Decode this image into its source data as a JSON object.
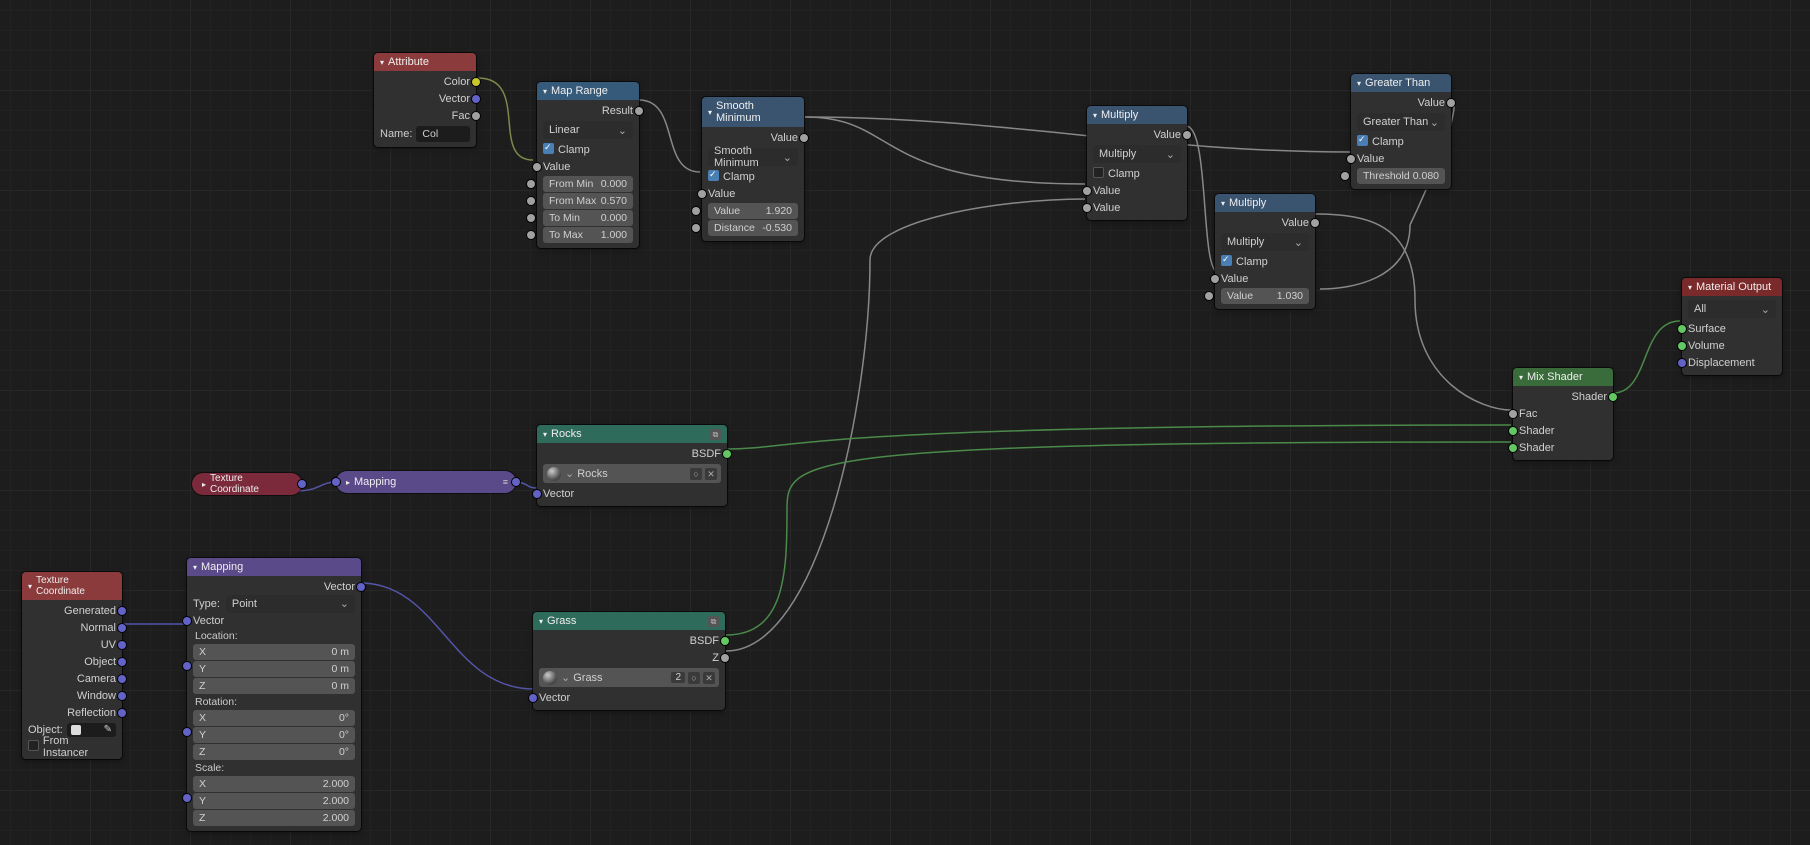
{
  "attribute": {
    "title": "Attribute",
    "out_color": "Color",
    "out_vector": "Vector",
    "out_fac": "Fac",
    "name_label": "Name:",
    "name_value": "Col"
  },
  "map_range": {
    "title": "Map Range",
    "out": "Result",
    "dropdown": "Linear",
    "clamp": "Clamp",
    "in_value": "Value",
    "from_min_l": "From Min",
    "from_min_v": "0.000",
    "from_max_l": "From Max",
    "from_max_v": "0.570",
    "to_min_l": "To Min",
    "to_min_v": "0.000",
    "to_max_l": "To Max",
    "to_max_v": "1.000"
  },
  "smooth_min": {
    "title": "Smooth Minimum",
    "out": "Value",
    "dropdown": "Smooth Minimum",
    "clamp": "Clamp",
    "in_value": "Value",
    "value_l": "Value",
    "value_v": "1.920",
    "dist_l": "Distance",
    "dist_v": "-0.530"
  },
  "multiply1": {
    "title": "Multiply",
    "out": "Value",
    "dropdown": "Multiply",
    "clamp": "Clamp",
    "v1": "Value",
    "v2": "Value"
  },
  "greater": {
    "title": "Greater Than",
    "out": "Value",
    "dropdown": "Greater Than",
    "clamp": "Clamp",
    "in_value": "Value",
    "thr_l": "Threshold",
    "thr_v": "0.080"
  },
  "multiply2": {
    "title": "Multiply",
    "out": "Value",
    "dropdown": "Multiply",
    "clamp": "Clamp",
    "in_value": "Value",
    "val_l": "Value",
    "val_v": "1.030"
  },
  "texcoord_pill": {
    "title": "Texture Coordinate"
  },
  "mapping_pill": {
    "title": "Mapping"
  },
  "rocks": {
    "title": "Rocks",
    "out": "BSDF",
    "mat": "Rocks",
    "in": "Vector"
  },
  "grass": {
    "title": "Grass",
    "out_bsdf": "BSDF",
    "out_z": "Z",
    "mat": "Grass",
    "mat_users": "2",
    "in": "Vector"
  },
  "texcoord": {
    "title": "Texture Coordinate",
    "generated": "Generated",
    "normal": "Normal",
    "uv": "UV",
    "object": "Object",
    "camera": "Camera",
    "window": "Window",
    "reflection": "Reflection",
    "object_label": "Object:",
    "from_instancer": "From Instancer"
  },
  "mapping": {
    "title": "Mapping",
    "out": "Vector",
    "type_l": "Type:",
    "type_v": "Point",
    "in_vector": "Vector",
    "location": "Location:",
    "rotation": "Rotation:",
    "scale": "Scale:",
    "x": "X",
    "y": "Y",
    "z": "Z",
    "zero_m": "0 m",
    "zero_deg": "0°",
    "two": "2.000"
  },
  "mix": {
    "title": "Mix Shader",
    "out": "Shader",
    "fac": "Fac",
    "sh1": "Shader",
    "sh2": "Shader"
  },
  "matout": {
    "title": "Material Output",
    "dropdown": "All",
    "surface": "Surface",
    "volume": "Volume",
    "disp": "Displacement"
  }
}
